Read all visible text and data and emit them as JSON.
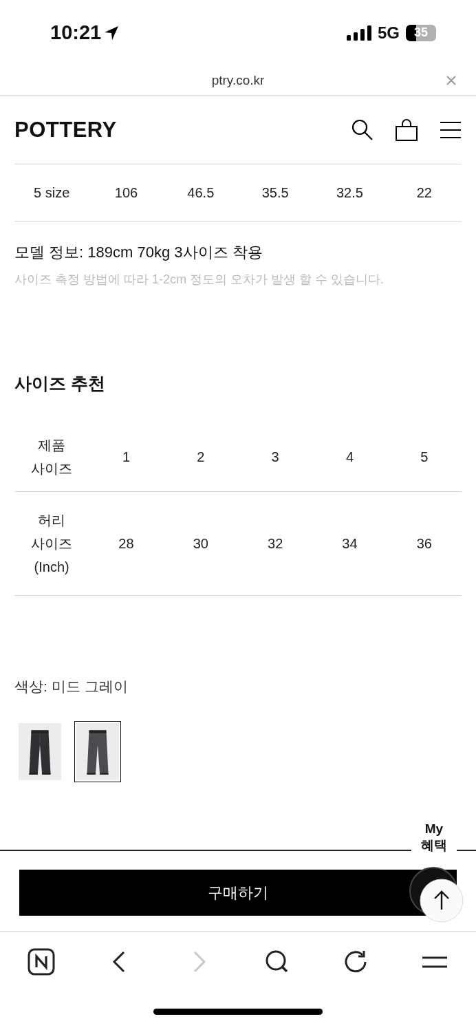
{
  "status_bar": {
    "time": "10:21",
    "network": "5G",
    "battery": "35"
  },
  "browser": {
    "url": "ptry.co.kr"
  },
  "header": {
    "logo": "POTTERY"
  },
  "size_table_last_row": {
    "cells": [
      "5 size",
      "106",
      "46.5",
      "35.5",
      "32.5",
      "22"
    ]
  },
  "model_info": "모델 정보: 189cm 70kg 3사이즈 착용",
  "size_note": "사이즈 측정 방법에 따라 1-2cm 정도의 오차가 발생 할 수 있습니다.",
  "recommend": {
    "title": "사이즈 추천",
    "rows": [
      {
        "label": "제품\n사이즈",
        "cells": [
          "1",
          "2",
          "3",
          "4",
          "5"
        ]
      },
      {
        "label": "허리\n사이즈\n(Inch)",
        "cells": [
          "28",
          "30",
          "32",
          "34",
          "36"
        ]
      }
    ]
  },
  "color": {
    "label": "색상: 미드 그레이",
    "swatches": [
      {
        "kind": "picture",
        "selected": false
      },
      {
        "kind": "picture",
        "selected": true
      }
    ]
  },
  "benefit": {
    "label": "My\n혜택"
  },
  "buy_button": "구매하기",
  "toolbar": [
    {
      "kind": "naver",
      "disabled": false
    },
    {
      "kind": "back",
      "disabled": false
    },
    {
      "kind": "forward",
      "disabled": true
    },
    {
      "kind": "search",
      "disabled": false
    },
    {
      "kind": "reload",
      "disabled": false
    },
    {
      "kind": "menu",
      "disabled": false
    }
  ]
}
